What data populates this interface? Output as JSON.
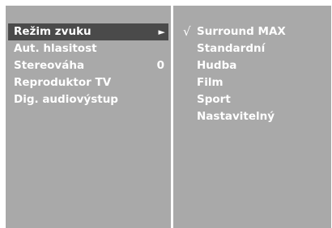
{
  "menu": {
    "items": [
      {
        "label": "Režim zvuku",
        "value": "",
        "selected": true,
        "has_submenu": true
      },
      {
        "label": "Aut. hlasitost",
        "value": "",
        "selected": false,
        "has_submenu": false
      },
      {
        "label": "Stereováha",
        "value": "0",
        "selected": false,
        "has_submenu": false
      },
      {
        "label": "Reproduktor TV",
        "value": "",
        "selected": false,
        "has_submenu": false
      },
      {
        "label": "Dig. audiovýstup",
        "value": "",
        "selected": false,
        "has_submenu": false
      }
    ],
    "submenu_arrow": "►"
  },
  "submenu": {
    "check_mark": "√",
    "options": [
      {
        "label": "Surround MAX",
        "checked": true
      },
      {
        "label": "Standardní",
        "checked": false
      },
      {
        "label": "Hudba",
        "checked": false
      },
      {
        "label": "Film",
        "checked": false
      },
      {
        "label": "Sport",
        "checked": false
      },
      {
        "label": "Nastavitelný",
        "checked": false
      }
    ]
  },
  "colors": {
    "background": "#a9a9a9",
    "highlight": "#4a4a4a",
    "text": "#ffffff"
  }
}
